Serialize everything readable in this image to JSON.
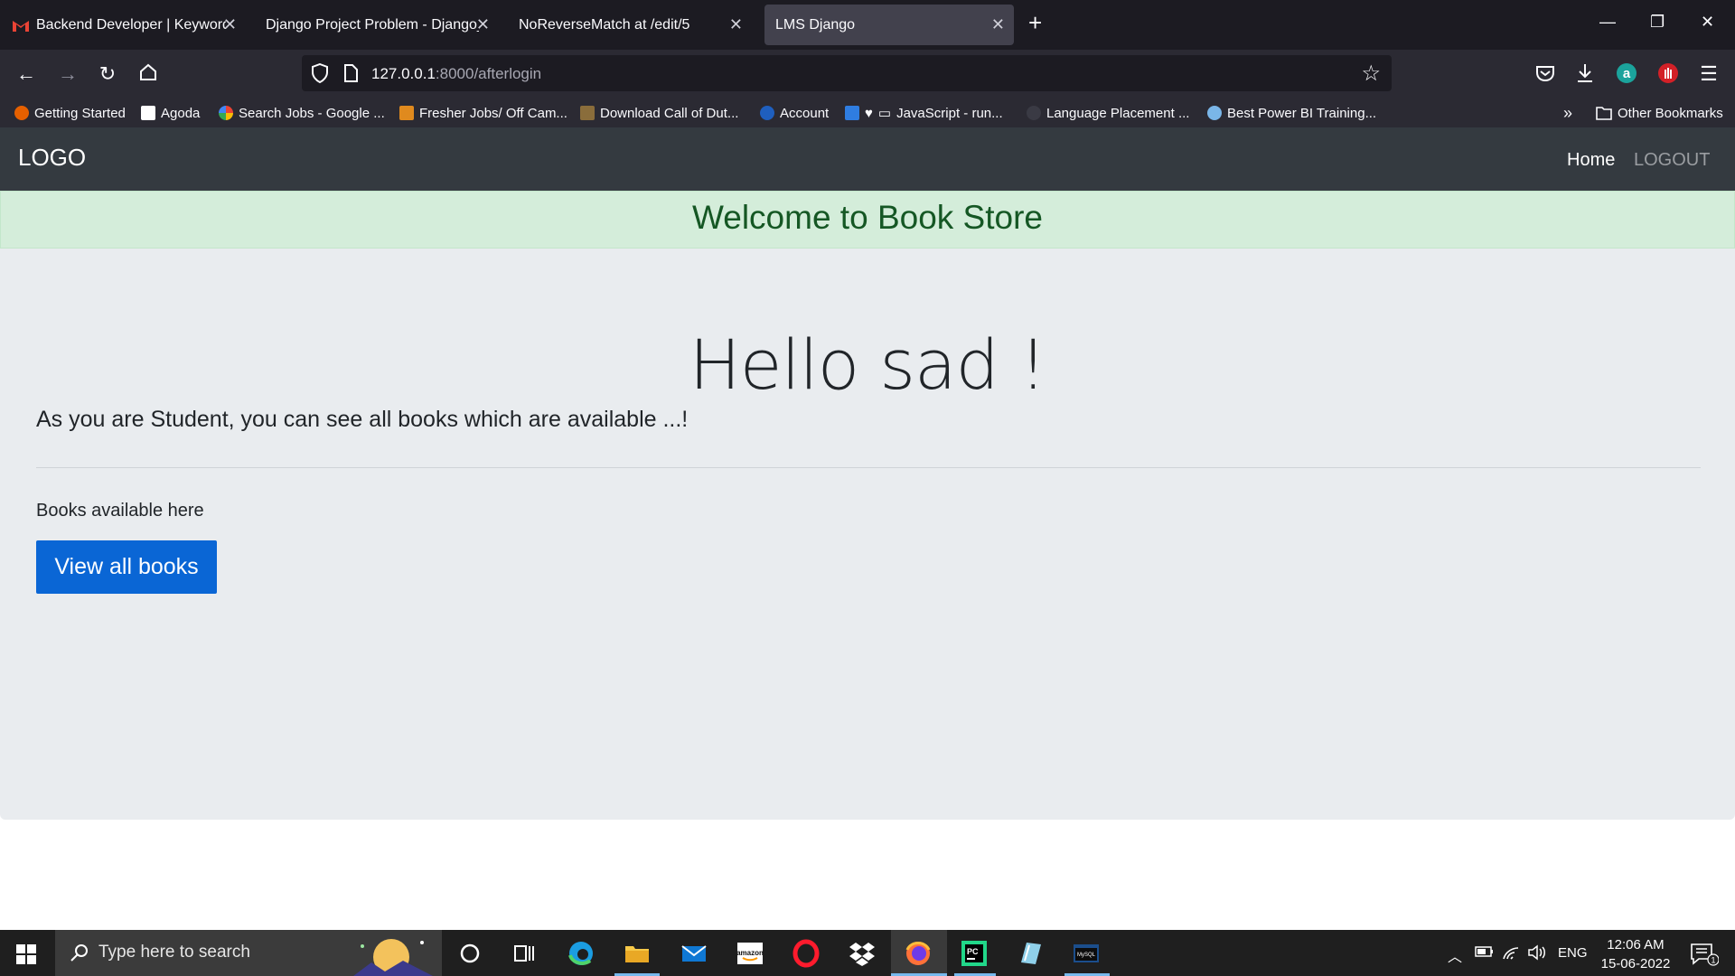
{
  "browser": {
    "tabs": [
      {
        "title": "Backend Developer | Keywordic",
        "active": false
      },
      {
        "title": "Django Project Problem - Django_P",
        "active": false
      },
      {
        "title": "NoReverseMatch at /edit/5",
        "active": false
      },
      {
        "title": "LMS Django",
        "active": true
      }
    ],
    "url": {
      "host": "127.0.0.1",
      "rest": ":8000/afterlogin"
    },
    "bookmarks": [
      "Getting Started",
      "Agoda",
      "Search Jobs - Google ...",
      "Fresher Jobs/ Off Cam...",
      "Download Call of Dut...",
      "Account",
      "JavaScript - run...",
      "Language Placement ...",
      "Best Power BI Training..."
    ],
    "other_bookmarks": "Other Bookmarks"
  },
  "site": {
    "logo": "LOGO",
    "nav": {
      "home": "Home",
      "logout": "LOGOUT"
    },
    "alert": "Welcome to Book Store",
    "greeting": "Hello sad !",
    "lead": "As you are Student, you can see all books which are available ...!",
    "books_text": "Books available here",
    "view_button": "View all books"
  },
  "taskbar": {
    "search_placeholder": "Type here to search",
    "language": "ENG",
    "time": "12:06 AM",
    "date": "15-06-2022",
    "notification_count": "1"
  },
  "colors": {
    "alert_bg": "#d4edda",
    "alert_text": "#155724",
    "button": "#0a66d5",
    "jumbotron": "#e9ecef",
    "site_nav": "#343a40"
  }
}
